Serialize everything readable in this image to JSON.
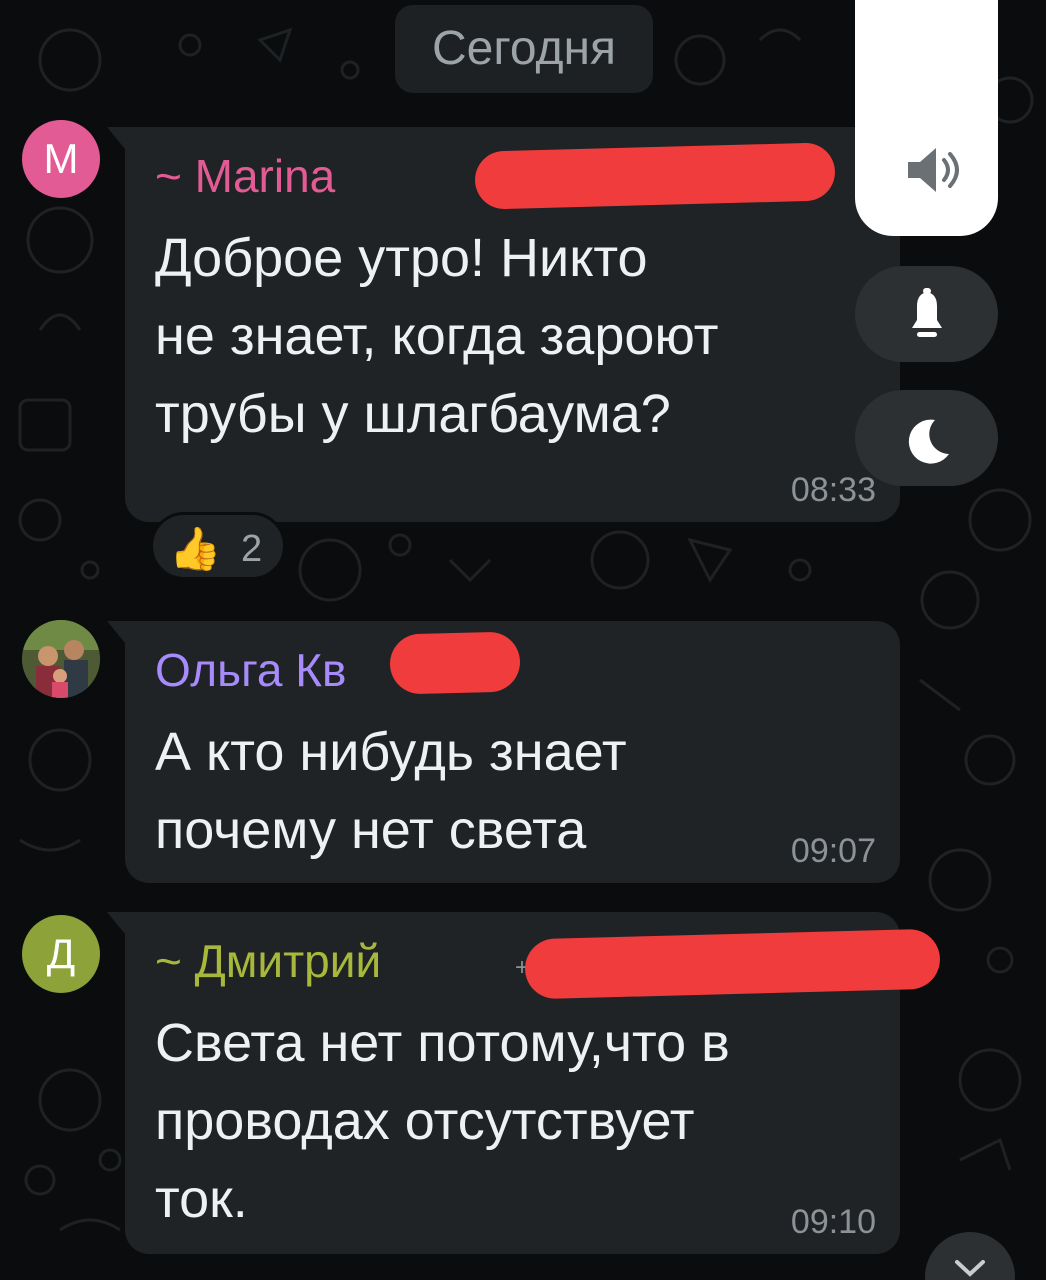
{
  "date_divider": "Сегодня",
  "messages": [
    {
      "avatar_letter": "M",
      "sender": "~ Marina",
      "phone_visible": "+",
      "text": "Доброе  утро!  Никто\nне знает, когда  зароют\nтрубы у  шлагбаума?",
      "time": "08:33",
      "reaction": {
        "emoji": "👍",
        "count": "2"
      }
    },
    {
      "sender": "Ольга Кв",
      "text": "А кто нибудь знает\nпочему нет света",
      "time": "09:07"
    },
    {
      "avatar_letter": "Д",
      "sender": "~ Дмитрий",
      "phone_visible": "+",
      "text": "Света нет потому,что в\nпроводах отсутствует\nток.",
      "time": "09:10"
    }
  ],
  "icons": {
    "volume": "speaker-icon",
    "bell": "bell-icon",
    "moon": "moon-icon",
    "scroll_down": "chevron-down-icon"
  },
  "colors": {
    "background": "#0b0c0d",
    "bubble": "#1f2326",
    "marina": "#e35b95",
    "olga": "#a78bfa",
    "dmitry": "#a8b83a",
    "redaction": "#f03c3c"
  }
}
